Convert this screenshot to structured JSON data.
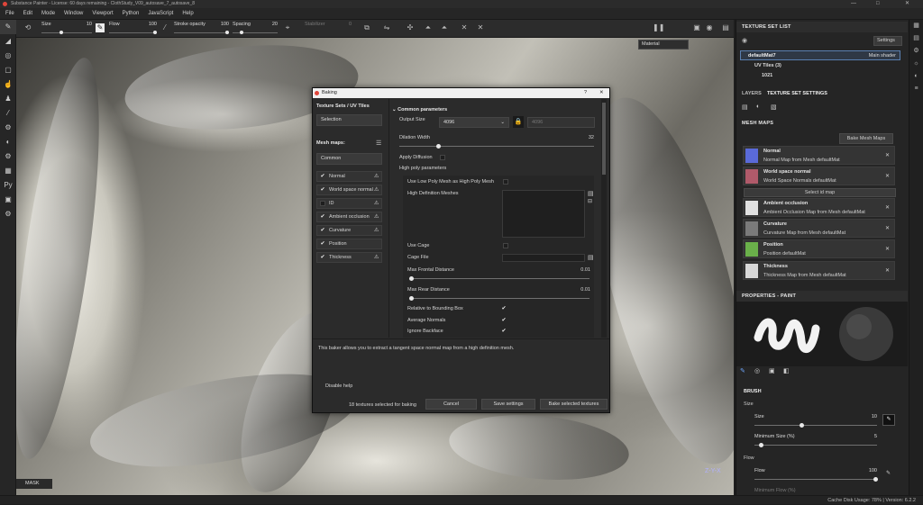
{
  "app": {
    "title": "Substance Painter - License: 60 days remaining - ClothStudy_V09_autosave_7_autosave_8"
  },
  "menu": [
    "File",
    "Edit",
    "Mode",
    "Window",
    "Viewport",
    "Python",
    "JavaScript",
    "Help"
  ],
  "toolbar": {
    "size_label": "Size",
    "size_value": "10",
    "flow_label": "Flow",
    "flow_value": "100",
    "stroke_label": "Stroke opacity",
    "stroke_value": "100",
    "spacing_label": "Spacing",
    "spacing_value": "20",
    "stabilizer_label": "Stabilizer",
    "stabilizer_value": "0",
    "size_level": 0.4,
    "flow_level": 1.0,
    "stroke_level": 1.0,
    "spacing_level": 0.2
  },
  "viewport": {
    "material_label": "Material",
    "mask_label": "MASK"
  },
  "texture_set_list": {
    "title": "TEXTURE SET LIST",
    "settings_label": "Settings",
    "mat_name": "defaultMat7",
    "mat_shader": "Main shader",
    "uv_tiles": "UV Tiles (3)",
    "tile": "1021"
  },
  "tabs": {
    "layers": "LAYERS",
    "texture_set_settings": "TEXTURE SET SETTINGS"
  },
  "mesh_maps": {
    "title": "MESH MAPS",
    "bake_button": "Bake Mesh Maps",
    "select_id": "Select id map",
    "items": [
      {
        "name": "Normal",
        "desc": "Normal Map from Mesh defaultMat",
        "thumb": "#5a6ad8"
      },
      {
        "name": "World space normal",
        "desc": "World Space Normals defaultMat",
        "thumb": "#b05a6a"
      },
      {
        "name": "Ambient occlusion",
        "desc": "Ambient Occlusion Map from Mesh defaultMat",
        "thumb": "#e0e0e0"
      },
      {
        "name": "Curvature",
        "desc": "Curvature Map from Mesh defaultMat",
        "thumb": "#7a7a7a"
      },
      {
        "name": "Position",
        "desc": "Position defaultMat",
        "thumb": "#6ab04a"
      },
      {
        "name": "Thickness",
        "desc": "Thickness Map from Mesh defaultMat",
        "thumb": "#d8d8d8"
      }
    ]
  },
  "properties": {
    "title": "PROPERTIES - PAINT",
    "brush_title": "BRUSH",
    "size_section": "Size",
    "size_label": "Size",
    "size_value": "10",
    "min_size_label": "Minimum Size (%)",
    "min_size_value": "5",
    "flow_section": "Flow",
    "flow_label": "Flow",
    "flow_value": "100",
    "min_flow_label": "Minimum Flow (%)",
    "size_level": 0.38,
    "min_size_level": 0.05,
    "flow_level": 1.0
  },
  "status": {
    "text": "Cache Disk Usage: 78% | Version: 6.2.2"
  },
  "dialog": {
    "title": "Baking",
    "help_icon": "?",
    "tex_sets_title": "Texture Sets / UV Tiles",
    "selection_label": "Selection",
    "mesh_maps_label": "Mesh maps:",
    "common_label": "Common",
    "maps": [
      {
        "name": "Normal",
        "checked": true,
        "warn": true
      },
      {
        "name": "World space normal",
        "checked": true,
        "warn": true
      },
      {
        "name": "ID",
        "checked": false,
        "warn": true
      },
      {
        "name": "Ambient occlusion",
        "checked": true,
        "warn": true
      },
      {
        "name": "Curvature",
        "checked": true,
        "warn": true
      },
      {
        "name": "Position",
        "checked": true,
        "warn": false
      },
      {
        "name": "Thickness",
        "checked": true,
        "warn": true
      }
    ],
    "common_params": "Common parameters",
    "output_size_label": "Output Size",
    "output_size_value": "4096",
    "output_size_linked": "4096",
    "dilation_label": "Dilation Width",
    "dilation_value": "32",
    "dilation_level": 0.2,
    "apply_diffusion": "Apply Diffusion",
    "high_poly": "High poly parameters",
    "use_low_poly": "Use Low Poly Mesh as High Poly Mesh",
    "hd_meshes": "High Definition Meshes",
    "use_cage": "Use Cage",
    "cage_file": "Cage File",
    "max_frontal_label": "Max Frontal Distance",
    "max_frontal_value": "0.01",
    "max_frontal_level": 0.01,
    "max_rear_label": "Max Rear Distance",
    "max_rear_value": "0.01",
    "max_rear_level": 0.01,
    "relative_bbox": "Relative to Bounding Box",
    "average_normals": "Average Normals",
    "ignore_backface": "Ignore Backface",
    "help_text": "This baker allows you to extract a tangent space normal map from a high definition mesh.",
    "disable_help": "Disable help",
    "count_text": "18 textures selected for baking",
    "cancel": "Cancel",
    "save_settings": "Save settings",
    "bake_selected": "Bake selected textures"
  }
}
